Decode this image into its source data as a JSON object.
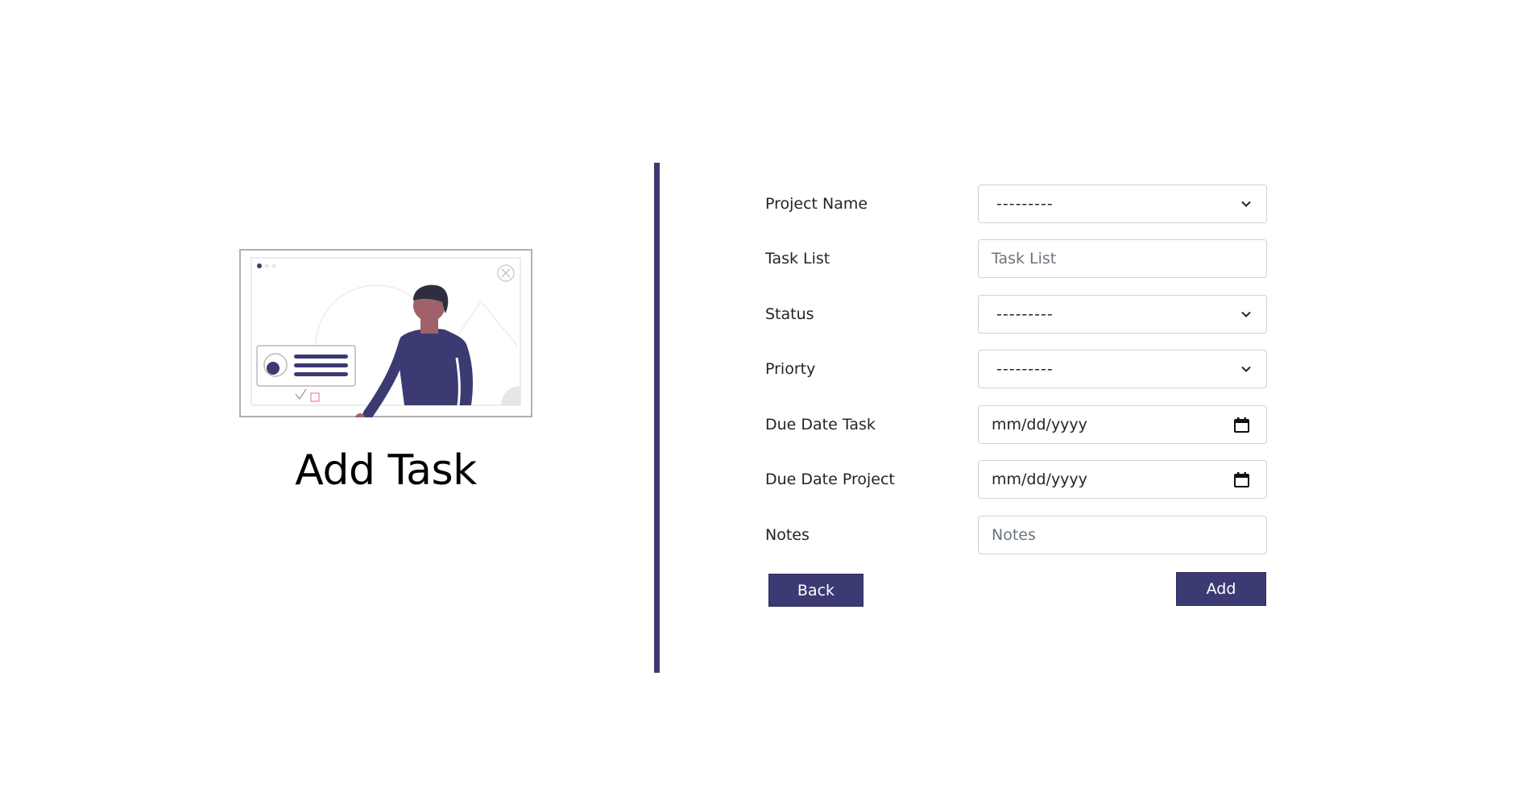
{
  "page": {
    "title": "Add Task",
    "accent_color": "#3c3a72"
  },
  "illustration": {
    "icon": "person-presenting-task-card-illustration"
  },
  "form": {
    "project_name": {
      "label": "Project Name",
      "value": "---------",
      "control": "select"
    },
    "task_list": {
      "label": "Task List",
      "placeholder": "Task List",
      "control": "text"
    },
    "status": {
      "label": "Status",
      "value": "---------",
      "control": "select"
    },
    "priority": {
      "label": "Priorty",
      "value": "---------",
      "control": "select"
    },
    "due_date_task": {
      "label": "Due Date Task",
      "placeholder": "mm/dd/yyyy",
      "control": "date"
    },
    "due_date_project": {
      "label": "Due Date Project",
      "placeholder": "mm/dd/yyyy",
      "control": "date"
    },
    "notes": {
      "label": "Notes",
      "placeholder": "Notes",
      "control": "text"
    }
  },
  "actions": {
    "back_label": "Back",
    "add_label": "Add"
  }
}
